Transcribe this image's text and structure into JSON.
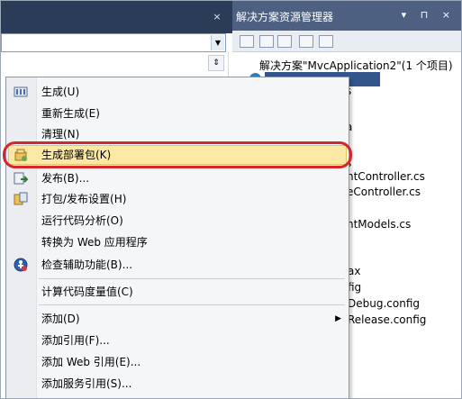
{
  "solution_explorer": {
    "title": "解决方案资源管理器",
    "title_buttons": "▾ ⊓ ×",
    "tree": [
      {
        "text": "解决方案\"MvcApplication2\"(1 个项目)"
      },
      {
        "text": "ntController.cs"
      },
      {
        "text": "eController.cs"
      },
      {
        "text": "ntModels.cs"
      },
      {
        "text": "ax"
      },
      {
        "text": "fig"
      },
      {
        "text": "Debug.config"
      },
      {
        "text": "Release.config"
      }
    ],
    "tree_fragments": [
      "s",
      "a",
      "s"
    ]
  },
  "editor": {
    "close_glyph": "×",
    "combo_arrow": "▼",
    "scroll_button": "⇕"
  },
  "context_menu": {
    "submenu_arrow": "▶",
    "items": [
      {
        "label": "生成(U)",
        "icon": "build-icon"
      },
      {
        "label": "重新生成(E)"
      },
      {
        "label": "清理(N)"
      },
      {
        "label": "生成部署包(K)",
        "icon": "package-icon",
        "highlighted": true
      },
      {
        "label": "发布(B)...",
        "icon": "publish-icon"
      },
      {
        "label": "打包/发布设置(H)",
        "icon": "settings-icon"
      },
      {
        "label": "运行代码分析(O)"
      },
      {
        "label": "转换为 Web 应用程序"
      },
      {
        "label": "检查辅助功能(B)...",
        "icon": "accessibility-icon"
      },
      {
        "label": "计算代码度量值(C)"
      },
      {
        "label": "添加(D)",
        "submenu": true
      },
      {
        "label": "添加引用(F)..."
      },
      {
        "label": "添加 Web 引用(E)..."
      },
      {
        "label": "添加服务引用(S)..."
      }
    ]
  },
  "colors": {
    "highlight_ring": "#d4262b",
    "highlight_fill": "#fbe8a4",
    "title_bar": "#4d6082",
    "selection": "#33558c"
  }
}
